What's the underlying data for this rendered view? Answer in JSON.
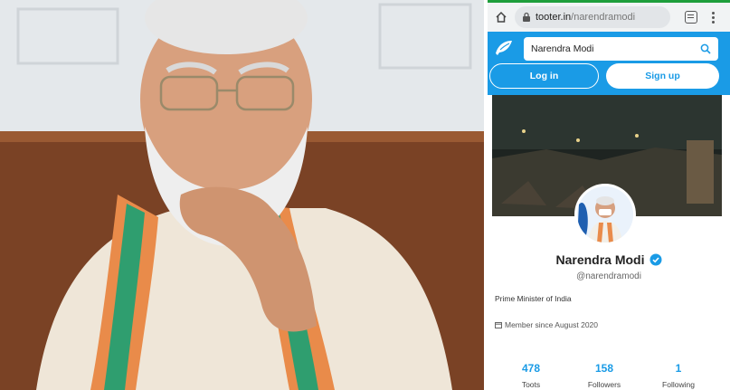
{
  "browser": {
    "url_host": "tooter.in",
    "url_path": "/narendramodi"
  },
  "header": {
    "search_value": "Narendra Modi",
    "login_label": "Log in",
    "signup_label": "Sign up"
  },
  "profile": {
    "name": "Narendra Modi",
    "handle": "@narendramodi",
    "bio": "Prime Minister of India",
    "member_since": "Member since August 2020",
    "stats": [
      {
        "value": "478",
        "label": "Toots"
      },
      {
        "value": "158",
        "label": "Followers"
      },
      {
        "value": "1",
        "label": "Following"
      }
    ]
  },
  "colors": {
    "brand_blue": "#1a9be6",
    "browser_bar": "#f1f3f4",
    "accent_green": "#1e9e3b"
  },
  "icons": [
    "home-icon",
    "lock-icon",
    "tabs-icon",
    "menu-icon",
    "tooter-logo-icon",
    "search-icon",
    "verified-icon",
    "calendar-icon"
  ]
}
